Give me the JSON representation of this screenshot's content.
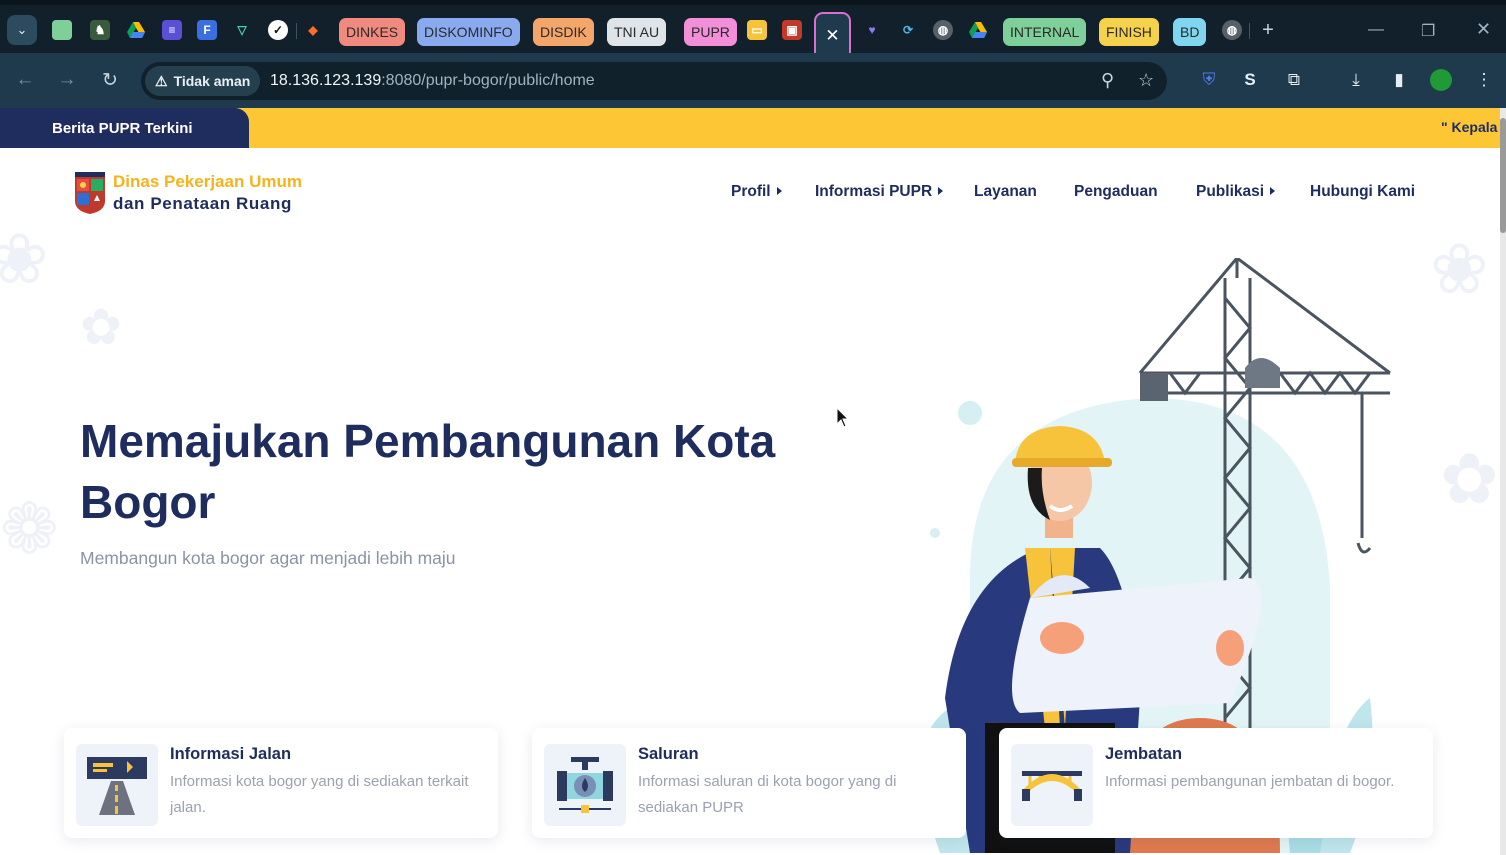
{
  "browser": {
    "tab_groups": [
      {
        "label": "DINKES",
        "color": "#f08a7e"
      },
      {
        "label": "DISKOMINFO",
        "color": "#8aaaf0"
      },
      {
        "label": "DISDIK",
        "color": "#f4a56a"
      },
      {
        "label": "TNI AU",
        "color": "#dfe4e8"
      },
      {
        "label": "PUPR",
        "color": "#f28fd8"
      },
      {
        "label": "INTERNAL",
        "color": "#7fcf9a"
      },
      {
        "label": "FINISH",
        "color": "#f6d24c"
      },
      {
        "label": "BD",
        "color": "#7fd6ee"
      }
    ],
    "active_tab_close": "✕",
    "security_label": "Tidak aman",
    "url_host": "18.136.123.139",
    "url_rest": ":8080/pupr-bogor/public/home"
  },
  "site": {
    "ticker_label": "Berita PUPR Terkini",
    "ticker_text": "\" Kepala",
    "logo_line1": "Dinas Pekerjaan Umum",
    "logo_line2": "dan Penataan Ruang",
    "menu": [
      {
        "label": "Profil",
        "has_caret": true
      },
      {
        "label": "Informasi PUPR",
        "has_caret": true
      },
      {
        "label": "Layanan",
        "has_caret": false
      },
      {
        "label": "Pengaduan",
        "has_caret": false
      },
      {
        "label": "Publikasi",
        "has_caret": true
      },
      {
        "label": "Hubungi Kami",
        "has_caret": false
      }
    ],
    "hero_title": "Memajukan Pembangunan Kota Bogor",
    "hero_subtitle": "Membangun kota bogor agar menjadi lebih maju",
    "cards": [
      {
        "title": "Informasi Jalan",
        "desc": "Informasi kota bogor yang di sediakan terkait jalan.",
        "icon": "road-icon"
      },
      {
        "title": "Saluran",
        "desc": "Informasi saluran di kota bogor yang di sediakan PUPR",
        "icon": "pipe-icon"
      },
      {
        "title": "Jembatan",
        "desc": "Informasi pembangunan jembatan di bogor.",
        "icon": "bridge-icon"
      }
    ],
    "colors": {
      "navy": "#1e2d5e",
      "yellow": "#fcc635",
      "gold": "#f7b31b"
    }
  }
}
